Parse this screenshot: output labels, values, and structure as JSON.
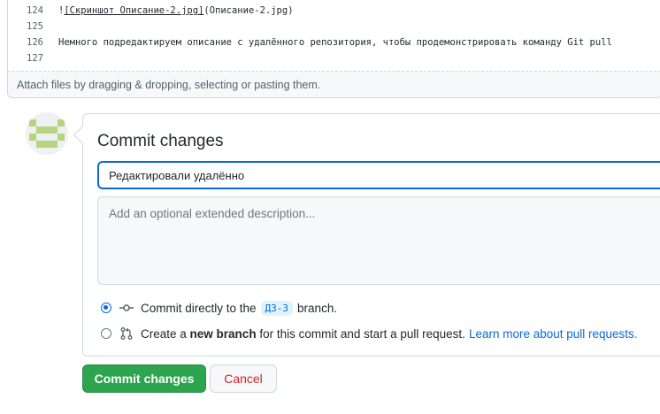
{
  "editor": {
    "lines": [
      {
        "number": "124",
        "text_prefix": "!",
        "link_text": "[Скриншот Описание-2.jpg]",
        "text_suffix": "(Описание-2.jpg)"
      },
      {
        "number": "125",
        "text": ""
      },
      {
        "number": "126",
        "text": "Немного подредактируем описание с удалённого репозитория, чтобы продемонстрировать команду Git pull"
      },
      {
        "number": "127",
        "text": ""
      }
    ],
    "attach_hint": "Attach files by dragging & dropping, selecting or pasting them."
  },
  "avatar": {
    "icon": "identicon-avatar",
    "color": "#b5d67f"
  },
  "commit": {
    "title": "Commit changes",
    "summary_value": "Редактировали удалённо",
    "description_placeholder": "Add an optional extended description...",
    "options": {
      "direct": {
        "text_before": "Commit directly to the",
        "branch": "ДЗ-3",
        "text_after": "branch.",
        "icon": "git-commit-icon",
        "selected": true
      },
      "new_branch": {
        "text_before": "Create a",
        "bold": "new branch",
        "text_after": "for this commit and start a pull request.",
        "link": "Learn more about pull requests.",
        "icon": "git-pull-request-icon",
        "selected": false
      }
    }
  },
  "buttons": {
    "commit": "Commit changes",
    "cancel": "Cancel"
  },
  "colors": {
    "primary": "#2da44e",
    "accent": "#0969da",
    "danger": "#cf222e"
  }
}
